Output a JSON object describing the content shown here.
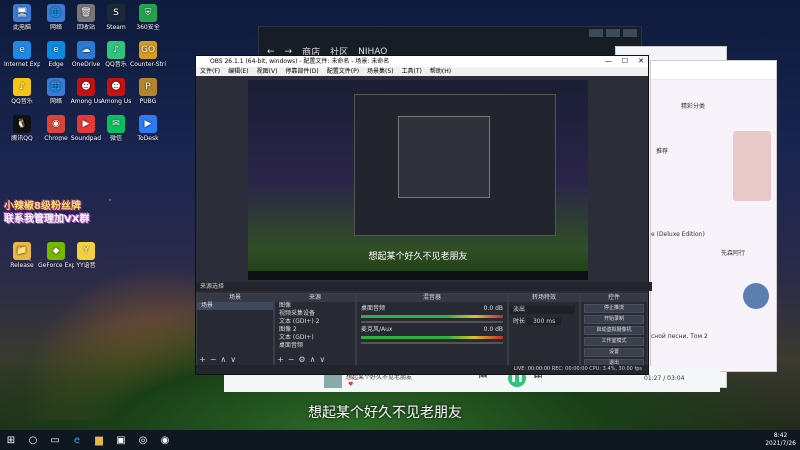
{
  "desktop_icons": [
    {
      "label": "此电脑",
      "glyph": "🖥",
      "color": "#3b7bd6"
    },
    {
      "label": "网络",
      "glyph": "🌐",
      "color": "#3b7bd6"
    },
    {
      "label": "回收站",
      "glyph": "🗑",
      "color": "#777"
    },
    {
      "label": "Steam",
      "glyph": "S",
      "color": "#1b2838"
    },
    {
      "label": "360安全",
      "glyph": "⛨",
      "color": "#23a34e"
    },
    {
      "label": "Internet Explorer",
      "glyph": "e",
      "color": "#1e88e5"
    },
    {
      "label": "Edge",
      "glyph": "e",
      "color": "#0c8ae0"
    },
    {
      "label": "OneDrive",
      "glyph": "☁",
      "color": "#2a7ad2"
    },
    {
      "label": "QQ音乐",
      "glyph": "♪",
      "color": "#31c27c"
    },
    {
      "label": "Counter-Strike Global Offe...",
      "glyph": "GO",
      "color": "#d89b1e"
    },
    {
      "label": "QQ音乐",
      "glyph": "♪",
      "color": "#f5c518"
    },
    {
      "label": "网络",
      "glyph": "🌐",
      "color": "#3b7bd6"
    },
    {
      "label": "Among Us",
      "glyph": "☻",
      "color": "#c51111"
    },
    {
      "label": "Among Us",
      "glyph": "☻",
      "color": "#c51111"
    },
    {
      "label": "PUBG",
      "glyph": "P",
      "color": "#b4862c"
    },
    {
      "label": "腾讯QQ",
      "glyph": "🐧",
      "color": "#111"
    },
    {
      "label": "Chrome",
      "glyph": "◉",
      "color": "#db4437"
    },
    {
      "label": "Soundpad",
      "glyph": "▶",
      "color": "#e53935"
    },
    {
      "label": "微信",
      "glyph": "✉",
      "color": "#07c160"
    },
    {
      "label": "ToDesk",
      "glyph": "▶",
      "color": "#2b7cf6"
    },
    {
      "label": "Release",
      "glyph": "📁",
      "color": "#e6b84a"
    },
    {
      "label": "GeForce Experience",
      "glyph": "◆",
      "color": "#76b900"
    },
    {
      "label": "YY语音",
      "glyph": "Y",
      "color": "#f4d03f"
    }
  ],
  "banner": {
    "line1": "小辣椒8级粉丝牌",
    "line2": "联系我管理加VX群"
  },
  "steam": {
    "back": "←",
    "forward": "→",
    "store": "商店",
    "community": "社区",
    "user": "NIHAO"
  },
  "obs": {
    "title": "OBS 26.1.1 (64-bit, windows) - 配置文件: 未命名 - 场景: 未命名",
    "menu": [
      "文件(F)",
      "编辑(E)",
      "视图(V)",
      "停靠部件(D)",
      "配置文件(P)",
      "场景集(S)",
      "工具(T)",
      "帮助(H)"
    ],
    "preview_subtitle": "想起某个好久不见老朋友",
    "scene_bar": "来源选择",
    "scenes": {
      "header": "场景",
      "items": [
        "场景"
      ]
    },
    "sources": {
      "header": "来源",
      "items": [
        "图像",
        "视频采集设备",
        "文本 (GDI+) 2",
        "图像 2",
        "文本 (GDI+)",
        "桌面音频"
      ]
    },
    "mixer": {
      "header": "混音器",
      "channels": [
        {
          "name": "桌面音频",
          "db": "0.0 dB"
        },
        {
          "name": "麦克风/Aux",
          "db": "0.0 dB"
        }
      ]
    },
    "transitions": {
      "header": "转场特效",
      "type": "淡出",
      "duration_label": "时长",
      "duration": "300 ms"
    },
    "controls": {
      "header": "控件",
      "buttons": [
        "停止推流",
        "开始录制",
        "启动虚拟摄像机",
        "工作室模式",
        "设置",
        "退出"
      ]
    },
    "status": "LIVE: 00:00:00  REC: 00:00:00  CPU: 3.4%, 30.00 fps"
  },
  "right_windows": {
    "recommend": "精彩分类",
    "recommend_tab": "推荐",
    "album": "e (Deluxe Edition)",
    "artist": "先森阿行",
    "song": "сной песни, Том 2"
  },
  "music_player": {
    "now_playing": "想起某个好久不见老朋友",
    "time": "01:27 / 03:04"
  },
  "big_subtitle": "想起某个好久不见老朋友",
  "taskbar": {
    "time": "8:42",
    "date": "2021/7/26"
  }
}
